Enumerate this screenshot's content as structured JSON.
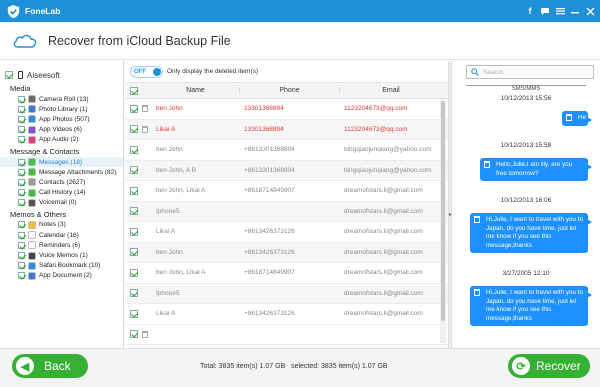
{
  "app": {
    "name": "FoneLab"
  },
  "header": {
    "title": "Recover from iCloud Backup File"
  },
  "sidebar": {
    "root_label": "Aiseesoft",
    "categories": [
      {
        "label": "Media",
        "items": [
          {
            "label": "Camera Roll (13)",
            "color": "#6a6a6a"
          },
          {
            "label": "Photo Library (1)",
            "color": "#3a7bd5"
          },
          {
            "label": "App Photos (507)",
            "color": "#2e8fe0"
          },
          {
            "label": "App Videos (6)",
            "color": "#8a4fd8"
          },
          {
            "label": "App Audio (2)",
            "color": "#e0407a"
          }
        ]
      },
      {
        "label": "Message & Contacts",
        "items": [
          {
            "label": "Messages (18)",
            "color": "#3cc23c"
          },
          {
            "label": "Message Attachments (82)",
            "color": "#3cc23c"
          },
          {
            "label": "Contacts (2627)",
            "color": "#9a9a9a"
          },
          {
            "label": "Call History (14)",
            "color": "#3cc23c"
          },
          {
            "label": "Voicemail (0)",
            "color": "#555555"
          }
        ]
      },
      {
        "label": "Memos & Others",
        "items": [
          {
            "label": "Notes (3)",
            "color": "#f2c230"
          },
          {
            "label": "Calendar (16)",
            "color": "#ffffff"
          },
          {
            "label": "Reminders (6)",
            "color": "#ffffff"
          },
          {
            "label": "Voice Memos (1)",
            "color": "#444444"
          },
          {
            "label": "Safari Bookmark (10)",
            "color": "#2e8fe0"
          },
          {
            "label": "App Document (2)",
            "color": "#3a7bd5"
          }
        ]
      }
    ]
  },
  "filter": {
    "toggle": "OFF",
    "label": "Only display the deleted item(s)"
  },
  "table": {
    "headers": {
      "name": "Name",
      "phone": "Phone",
      "email": "Email"
    },
    "rows": [
      {
        "name": "ben John",
        "phone": "13301368894",
        "email": "1123204673@qq.com",
        "deleted": true
      },
      {
        "name": "Likai A",
        "phone": "13301368894",
        "email": "1123204673@qq.com",
        "deleted": true
      },
      {
        "name": "ben John",
        "phone": "+8613301368894",
        "email": "bingqiaojunqiang@yahoo.com",
        "deleted": false
      },
      {
        "name": "ben John, A B",
        "phone": "+8613301368894",
        "email": "bingqiaojunqiang@yahoo.com",
        "deleted": false
      },
      {
        "name": "ben John, Likai A",
        "phone": "+8618714849907",
        "email": "dreamofstars.li@gmail.com",
        "deleted": false
      },
      {
        "name": "Iphone5",
        "phone": "",
        "email": "dreamofstars.li@gmail.com",
        "deleted": false
      },
      {
        "name": "Likai A",
        "phone": "+8613426373126",
        "email": "dreamofstars.li@gmail.com",
        "deleted": false
      },
      {
        "name": "ben John",
        "phone": "+8613426373126",
        "email": "dreamofstars.li@gmail.com",
        "deleted": false
      },
      {
        "name": "ben John, Likai A",
        "phone": "+8618714849907",
        "email": "dreamofstars.li@gmail.com",
        "deleted": false
      },
      {
        "name": "Iphone5",
        "phone": "",
        "email": "dreamofstars.li@gmail.com",
        "deleted": false
      },
      {
        "name": "Likai A",
        "phone": "+8613426373126",
        "email": "dreamofstars.li@gmail.com",
        "deleted": false
      }
    ]
  },
  "search": {
    "placeholder": "Search"
  },
  "sms": {
    "section_label": "SMS/MMS",
    "messages": [
      {
        "timestamp": "10/12/2013 15:56",
        "text": "He"
      },
      {
        "timestamp": "10/12/2013 15:58",
        "text": "Hello,Julie,I am lily, are you free tomorrow?"
      },
      {
        "timestamp": "10/12/2013 16:06",
        "text": "Hi,Julie, I want to travel with you to Japan, do you have time, just let me know if you see this message,thanks"
      },
      {
        "timestamp": "3/27/2005 12:10",
        "text": "Hi,Julie, I want to travel with you to Japan, do you have time, just let me know if you see this message,thanks"
      }
    ]
  },
  "footer": {
    "back_label": "Back",
    "recover_label": "Recover",
    "total_text": "Total: 3835 item(s) 1.07 GB",
    "selected_text": "selected: 3835 item(s) 1.07 GB"
  }
}
